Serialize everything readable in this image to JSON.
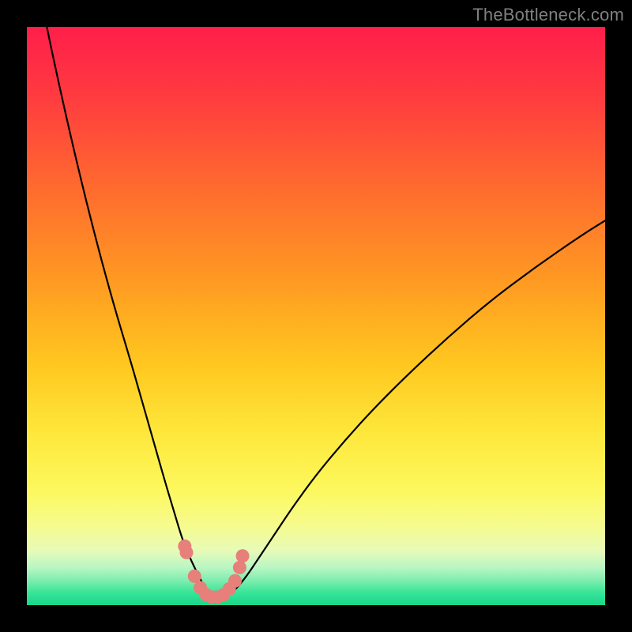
{
  "watermark": "TheBottleneck.com",
  "layout": {
    "outer_width": 800,
    "outer_height": 800,
    "inner_left": 34,
    "inner_top": 34,
    "inner_width": 732,
    "inner_height": 732
  },
  "colors": {
    "frame": "#000000",
    "curve": "#000000",
    "marker_fill": "#E77F7A",
    "marker_stroke": "#D86B66",
    "gradient_stops": [
      {
        "offset": 0.0,
        "color": "#FF1E4B"
      },
      {
        "offset": 0.12,
        "color": "#FF3B3F"
      },
      {
        "offset": 0.28,
        "color": "#FF6B2F"
      },
      {
        "offset": 0.44,
        "color": "#FF9A22"
      },
      {
        "offset": 0.58,
        "color": "#FFC61F"
      },
      {
        "offset": 0.7,
        "color": "#FEE73A"
      },
      {
        "offset": 0.8,
        "color": "#FDF85E"
      },
      {
        "offset": 0.86,
        "color": "#F6FB8B"
      },
      {
        "offset": 0.905,
        "color": "#E8FBB7"
      },
      {
        "offset": 0.935,
        "color": "#B9F6C4"
      },
      {
        "offset": 0.958,
        "color": "#7CEDAE"
      },
      {
        "offset": 0.978,
        "color": "#38E598"
      },
      {
        "offset": 1.0,
        "color": "#17D789"
      }
    ]
  },
  "chart_data": {
    "type": "line",
    "title": "",
    "xlabel": "",
    "ylabel": "",
    "xlim": [
      0,
      100
    ],
    "ylim": [
      0,
      100
    ],
    "grid": false,
    "legend": false,
    "series": [
      {
        "name": "bottleneck-curve",
        "x": [
          0,
          3,
          6,
          9,
          12,
          15,
          18,
          20,
          22,
          24,
          25.5,
          27,
          28.5,
          30,
          31,
          32,
          33,
          34.5,
          36,
          38,
          40,
          43,
          46,
          50,
          55,
          60,
          66,
          73,
          80,
          88,
          96,
          100
        ],
        "y": [
          118,
          102,
          88,
          75,
          63,
          52,
          42,
          35,
          28,
          21,
          16,
          11,
          7.5,
          4.5,
          2.6,
          1.4,
          1.0,
          1.4,
          2.6,
          5.0,
          8.0,
          12.5,
          17.0,
          22.5,
          28.5,
          34.0,
          40.0,
          46.5,
          52.5,
          58.5,
          64.0,
          66.5
        ]
      }
    ],
    "markers": {
      "name": "highlighted-points",
      "x": [
        27.3,
        27.6,
        29.0,
        30.0,
        31.0,
        32.0,
        33.0,
        34.0,
        35.0,
        36.0,
        36.8,
        37.3
      ],
      "y": [
        10.2,
        9.1,
        5.0,
        3.0,
        1.8,
        1.4,
        1.4,
        1.8,
        2.8,
        4.2,
        6.5,
        8.5
      ]
    }
  }
}
